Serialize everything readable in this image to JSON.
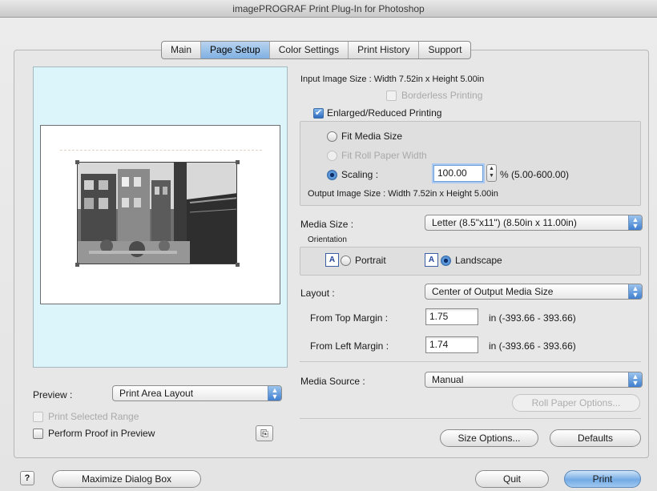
{
  "window": {
    "title": "imagePROGRAF Print Plug-In for Photoshop"
  },
  "tabs": [
    {
      "label": "Main"
    },
    {
      "label": "Page Setup",
      "active": true
    },
    {
      "label": "Color Settings"
    },
    {
      "label": "Print History"
    },
    {
      "label": "Support"
    }
  ],
  "page_setup": {
    "input_image_size": "Input Image Size : Width 7.52in x Height 5.00in",
    "borderless_printing": {
      "label": "Borderless Printing",
      "checked": false,
      "enabled": false
    },
    "enlarged_reduced": {
      "label": "Enlarged/Reduced Printing",
      "checked": true
    },
    "fit_media_size": {
      "label": "Fit Media Size",
      "selected": false
    },
    "fit_roll_paper_width": {
      "label": "Fit Roll Paper Width",
      "selected": false,
      "enabled": false
    },
    "scaling": {
      "label": "Scaling :",
      "selected": true,
      "value": "100.00",
      "range": "% (5.00-600.00)"
    },
    "output_image_size": "Output Image Size : Width 7.52in x Height 5.00in",
    "media_size": {
      "label": "Media Size :",
      "value": "Letter (8.5\"x11\") (8.50in x 11.00in)"
    },
    "orientation": {
      "label": "Orientation",
      "portrait": {
        "label": "Portrait",
        "selected": false,
        "icon_letter": "A"
      },
      "landscape": {
        "label": "Landscape",
        "selected": true,
        "icon_letter": "A"
      }
    },
    "layout": {
      "label": "Layout :",
      "value": "Center of Output Media Size"
    },
    "from_top_margin": {
      "label": "From Top Margin :",
      "value": "1.75",
      "range": "in  (-393.66 - 393.66)"
    },
    "from_left_margin": {
      "label": "From Left Margin :",
      "value": "1.74",
      "range": "in  (-393.66 - 393.66)"
    },
    "media_source": {
      "label": "Media Source :",
      "value": "Manual"
    },
    "roll_paper_options": "Roll Paper Options...",
    "size_options": "Size Options...",
    "defaults": "Defaults"
  },
  "preview": {
    "label": "Preview :",
    "mode": "Print Area Layout",
    "print_selected_range": {
      "label": "Print Selected Range",
      "checked": false,
      "enabled": false
    },
    "perform_proof": {
      "label": "Perform Proof in Preview",
      "checked": false
    }
  },
  "footer": {
    "help_icon": "?",
    "maximize": "Maximize Dialog Box",
    "quit": "Quit",
    "print": "Print"
  },
  "colors": {
    "accent": "#5a9be0",
    "preview_background": "#dcf5fb"
  },
  "icons": {
    "popup_arrows": "⇕",
    "stepper": "▲▼",
    "checkmark": "✔",
    "proof": "proof-icon"
  }
}
